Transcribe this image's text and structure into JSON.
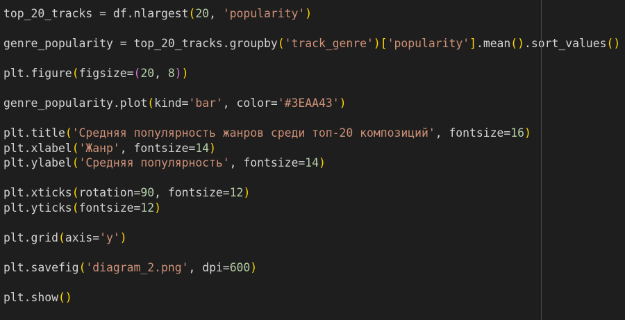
{
  "editor": {
    "colors": {
      "background": "#1e1e1e",
      "text": "#d4d4d4",
      "string": "#ce9178",
      "number": "#b5cea8",
      "bracket1": "#ffd700",
      "bracket2": "#da70d6"
    },
    "lines": [
      [
        [
          "txt",
          "top_20_tracks = df.nlargest"
        ],
        [
          "p1",
          "("
        ],
        [
          "num",
          "20"
        ],
        [
          "txt",
          ", "
        ],
        [
          "str",
          "'popularity'"
        ],
        [
          "p1",
          ")"
        ]
      ],
      [],
      [
        [
          "txt",
          "genre_popularity = top_20_tracks.groupby"
        ],
        [
          "p1",
          "("
        ],
        [
          "str",
          "'track_genre'"
        ],
        [
          "p1",
          ")["
        ],
        [
          "str",
          "'popularity'"
        ],
        [
          "p1",
          "]"
        ],
        [
          "txt",
          ".mean"
        ],
        [
          "p1",
          "()"
        ],
        [
          "txt",
          ".sort_values"
        ],
        [
          "p1",
          "()"
        ]
      ],
      [],
      [
        [
          "txt",
          "plt.figure"
        ],
        [
          "p1",
          "("
        ],
        [
          "txt",
          "figsize="
        ],
        [
          "p2",
          "("
        ],
        [
          "num",
          "20"
        ],
        [
          "txt",
          ", "
        ],
        [
          "num",
          "8"
        ],
        [
          "p2",
          ")"
        ],
        [
          "p1",
          ")"
        ]
      ],
      [],
      [
        [
          "txt",
          "genre_popularity.plot"
        ],
        [
          "p1",
          "("
        ],
        [
          "txt",
          "kind="
        ],
        [
          "str",
          "'bar'"
        ],
        [
          "txt",
          ", color="
        ],
        [
          "str",
          "'#3EAA43'"
        ],
        [
          "p1",
          ")"
        ]
      ],
      [],
      [
        [
          "txt",
          "plt.title"
        ],
        [
          "p1",
          "("
        ],
        [
          "str",
          "'Средняя популярность жанров среди топ-20 композиций'"
        ],
        [
          "txt",
          ", fontsize="
        ],
        [
          "num",
          "16"
        ],
        [
          "p1",
          ")"
        ]
      ],
      [
        [
          "txt",
          "plt.xlabel"
        ],
        [
          "p1",
          "("
        ],
        [
          "str",
          "'Жанр'"
        ],
        [
          "txt",
          ", fontsize="
        ],
        [
          "num",
          "14"
        ],
        [
          "p1",
          ")"
        ]
      ],
      [
        [
          "txt",
          "plt.ylabel"
        ],
        [
          "p1",
          "("
        ],
        [
          "str",
          "'Средняя популярность'"
        ],
        [
          "txt",
          ", fontsize="
        ],
        [
          "num",
          "14"
        ],
        [
          "p1",
          ")"
        ]
      ],
      [],
      [
        [
          "txt",
          "plt.xticks"
        ],
        [
          "p1",
          "("
        ],
        [
          "txt",
          "rotation="
        ],
        [
          "num",
          "90"
        ],
        [
          "txt",
          ", fontsize="
        ],
        [
          "num",
          "12"
        ],
        [
          "p1",
          ")"
        ]
      ],
      [
        [
          "txt",
          "plt.yticks"
        ],
        [
          "p1",
          "("
        ],
        [
          "txt",
          "fontsize="
        ],
        [
          "num",
          "12"
        ],
        [
          "p1",
          ")"
        ]
      ],
      [],
      [
        [
          "txt",
          "plt.grid"
        ],
        [
          "p1",
          "("
        ],
        [
          "txt",
          "axis="
        ],
        [
          "str",
          "'y'"
        ],
        [
          "p1",
          ")"
        ]
      ],
      [],
      [
        [
          "txt",
          "plt.savefig"
        ],
        [
          "p1",
          "("
        ],
        [
          "str",
          "'diagram_2.png'"
        ],
        [
          "txt",
          ", dpi="
        ],
        [
          "num",
          "600"
        ],
        [
          "p1",
          ")"
        ]
      ],
      [],
      [
        [
          "txt",
          "plt.show"
        ],
        [
          "p1",
          "()"
        ]
      ]
    ]
  }
}
